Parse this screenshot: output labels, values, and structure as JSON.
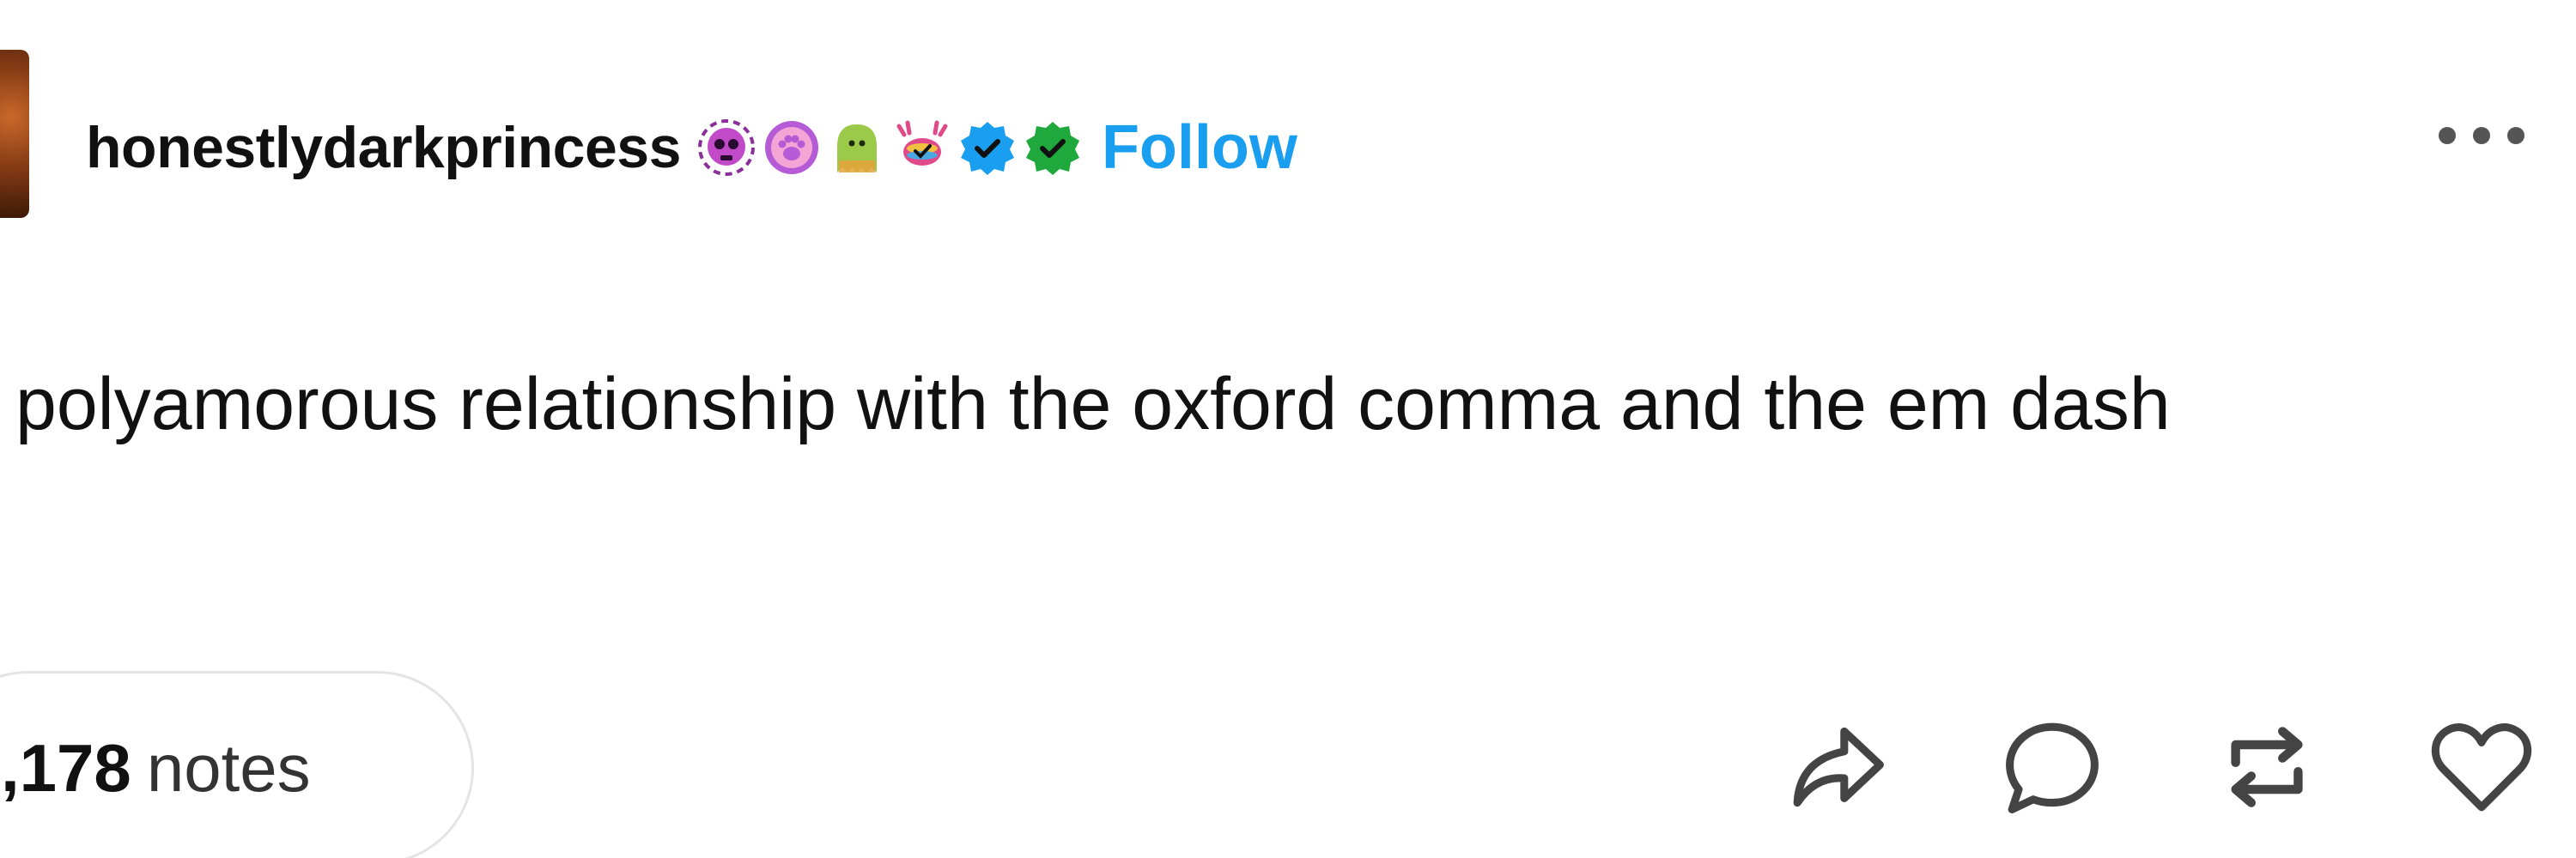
{
  "post": {
    "username": "honestlydarkprincess",
    "follow_label": "Follow",
    "body": "polyamorous relationship with the oxford comma and the em dash",
    "notes_count": ",178",
    "notes_label": "notes"
  },
  "badges": [
    {
      "icon": "skull-badge-icon",
      "color": "#c04ac8"
    },
    {
      "icon": "paw-badge-icon",
      "color": "#b55bd6"
    },
    {
      "icon": "ghost-badge-icon",
      "color": "#9bc94a"
    },
    {
      "icon": "crab-badge-icon",
      "color": "#e04a8a"
    },
    {
      "icon": "verified-blue-badge-icon",
      "color": "#1a9ff0"
    },
    {
      "icon": "verified-green-badge-icon",
      "color": "#1fa83c"
    }
  ],
  "actions": [
    {
      "icon": "share-icon"
    },
    {
      "icon": "reply-icon"
    },
    {
      "icon": "reblog-icon"
    },
    {
      "icon": "like-icon"
    }
  ],
  "colors": {
    "follow": "#1a9ff0",
    "icon_stroke": "#444444"
  }
}
